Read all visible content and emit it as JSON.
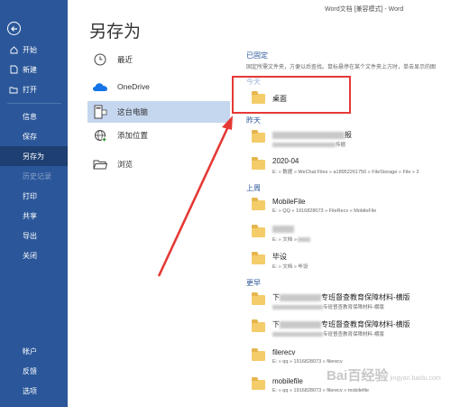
{
  "window_title": "Word文档 [兼容模式] - Word",
  "page_title": "另存为",
  "nav": {
    "items": [
      {
        "label": "开始",
        "icon": "home-icon"
      },
      {
        "label": "新建",
        "icon": "new-document-icon"
      },
      {
        "label": "打开",
        "icon": "open-folder-icon"
      },
      {
        "label": "信息"
      },
      {
        "label": "保存"
      },
      {
        "label": "另存为",
        "active": true
      },
      {
        "label": "历史记录",
        "disabled": true
      },
      {
        "label": "打印"
      },
      {
        "label": "共享"
      },
      {
        "label": "导出"
      },
      {
        "label": "关闭"
      },
      {
        "label": "帐户"
      },
      {
        "label": "反馈"
      },
      {
        "label": "选项"
      }
    ]
  },
  "places": [
    {
      "label": "最近",
      "icon": "clock-icon"
    },
    {
      "label": "OneDrive",
      "icon": "onedrive-cloud-icon"
    },
    {
      "label": "这台电脑",
      "icon": "this-pc-icon",
      "active": true
    },
    {
      "label": "添加位置",
      "icon": "add-location-globe-icon"
    },
    {
      "label": "浏览",
      "icon": "browse-folder-icon"
    }
  ],
  "pinned": {
    "header": "已固定",
    "note": "固定所需文件夹，方便以后查找。鼠标悬停在某个文件夹上方时，单击显示的图"
  },
  "sections": {
    "today": "今天",
    "yesterday": "昨天",
    "last_week": "上周",
    "earlier": "更早"
  },
  "folders": {
    "today": [
      {
        "name": "桌面"
      }
    ],
    "yesterday": [
      {
        "name": "报",
        "path": "传据"
      },
      {
        "name": "2020-04",
        "path": "E: » 数据 » WeChat Files » a18952261756 » FileStorage » File » 2"
      }
    ],
    "last_week": [
      {
        "name": "MobileFile",
        "path": "E: » QQ » 1916828073 » FileRecv » MobileFile"
      },
      {
        "name": "",
        "path": "E: » 文档 »"
      },
      {
        "name": "毕设",
        "path": "E: » 文档 » 毕设"
      }
    ],
    "earlier": [
      {
        "name": "专班督查教育保障材料-横版",
        "path": "专班督查教育保障材料-横版",
        "prefix": "下"
      },
      {
        "name": "专班督查教育保障材料-横版",
        "path": "专班督查教育保障材料-横版",
        "prefix": "下"
      },
      {
        "name": "filerecv",
        "path": "E: » qq » 1916828073 » filerecv"
      },
      {
        "name": "mobilefile",
        "path": "E: » qq » 1916828073 » filerecv » mobilefile"
      }
    ]
  },
  "watermark": {
    "text": "Bai百经验",
    "sub": "jingyan.baidu.com"
  },
  "colors": {
    "nav_bg": "#2b579a",
    "nav_active": "#1e3f71",
    "accent": "#2b579a",
    "annotation_red": "#e53935",
    "folder": "#f4cc6a"
  }
}
